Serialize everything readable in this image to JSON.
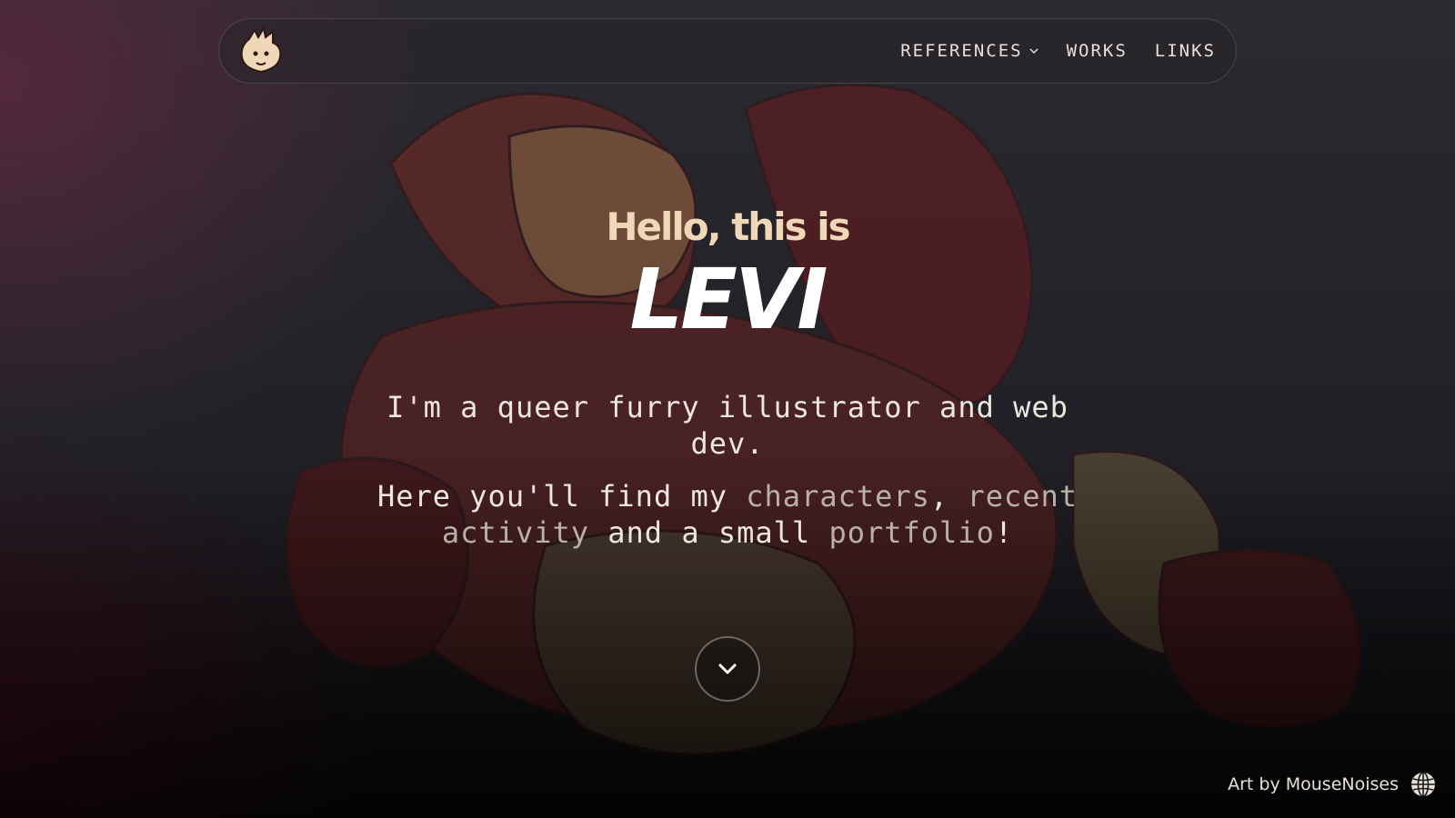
{
  "colors": {
    "accent_cream": "#f0d7b8",
    "text_light": "#ece6dc",
    "link_muted": "#b9b0a6",
    "bg_dark": "#1c1c20",
    "bg_wine": "#5a0a1e"
  },
  "nav": {
    "logo_icon": "fox-head-logo-icon",
    "items": [
      {
        "label": "REFERENCES",
        "has_dropdown": true
      },
      {
        "label": "WORKS"
      },
      {
        "label": "LINKS"
      }
    ]
  },
  "hero": {
    "greeting": "Hello, this is",
    "name": "LEVI",
    "tagline": "I'm a queer furry illustrator and web dev.",
    "intro": {
      "before": "Here you'll find my ",
      "link_characters": "characters",
      "comma": ", ",
      "link_activity": "recent activity",
      "middle": " and a small ",
      "link_portfolio": "portfolio",
      "end": "!"
    }
  },
  "scroll_button_icon": "chevron-down-icon",
  "credit": {
    "text": "Art by MouseNoises",
    "icon": "globe-icon"
  }
}
